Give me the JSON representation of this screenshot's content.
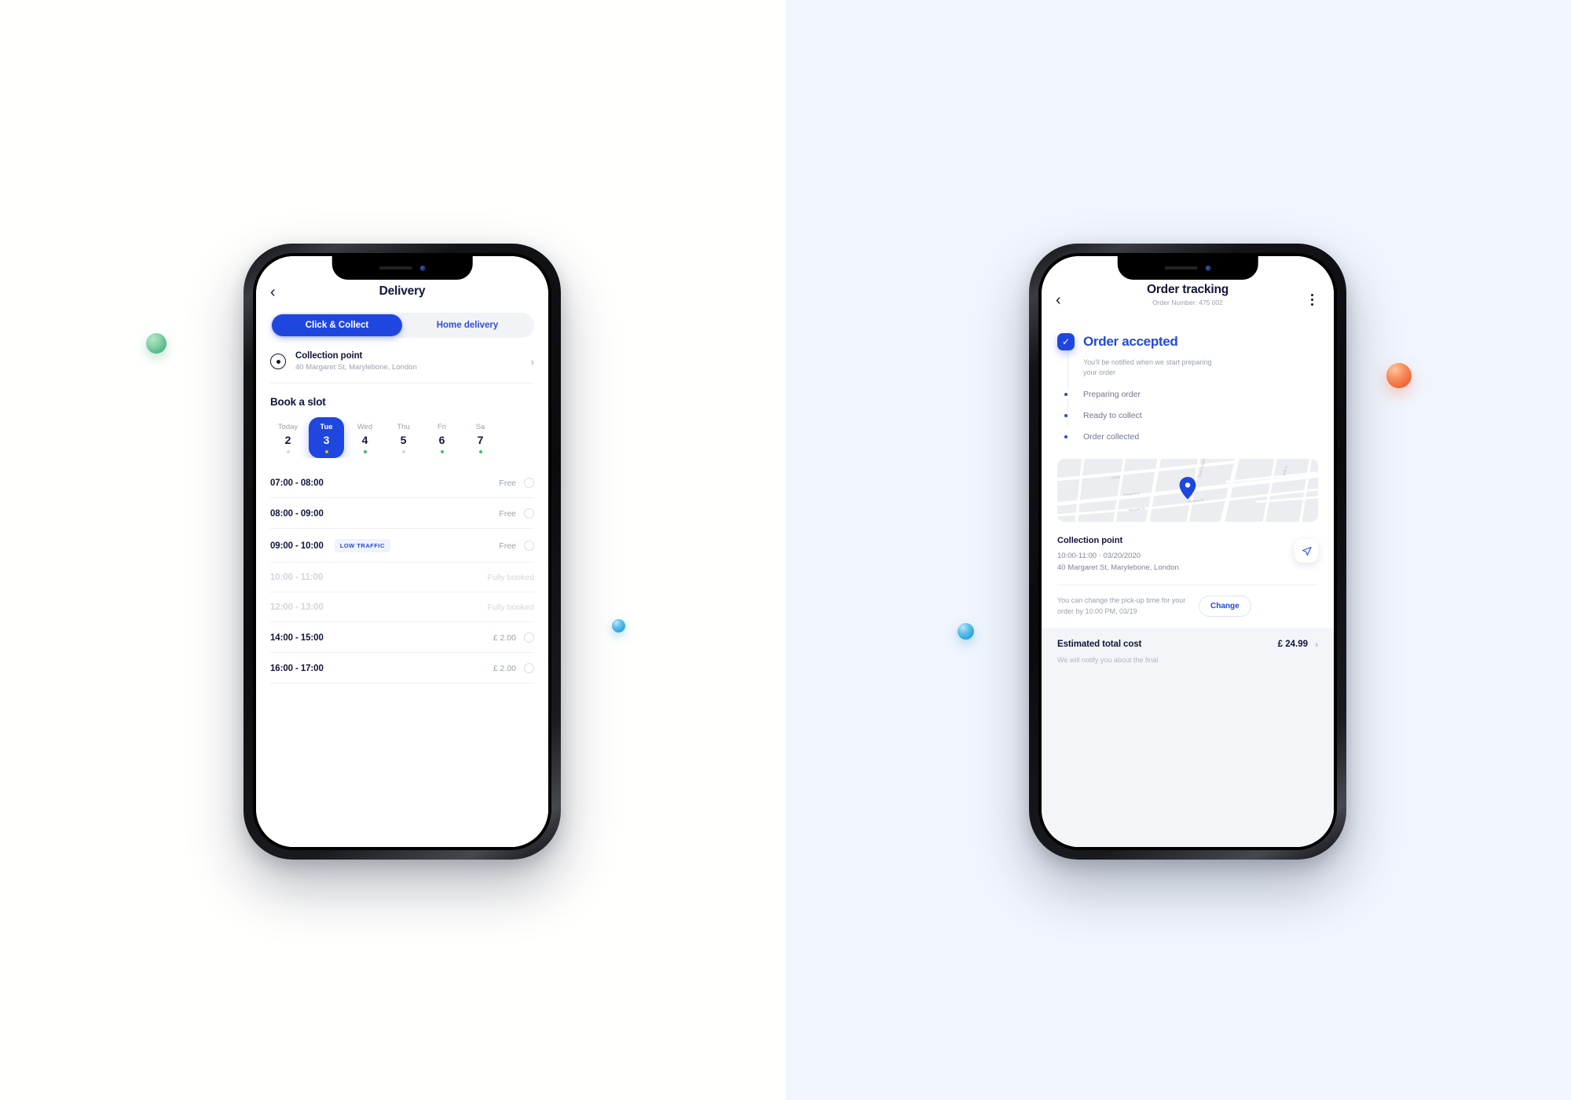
{
  "canvas": {
    "left_bg": "#FFFFFE",
    "right_bg": "#F1F5FD",
    "accent": "#1F47E0",
    "accent_text": "#2348DD"
  },
  "decorations": [
    {
      "name": "green-sphere",
      "color": "#4FB383"
    },
    {
      "name": "orange-sphere",
      "color": "#F2683A"
    },
    {
      "name": "blue-sphere-small",
      "color": "#2AA3DD"
    },
    {
      "name": "blue-sphere-large",
      "color": "#2AA3DD"
    }
  ],
  "left_phone": {
    "nav": {
      "back_icon": "chevron-left-icon",
      "title": "Delivery"
    },
    "segmented": {
      "options": [
        {
          "label": "Click & Collect",
          "active": true
        },
        {
          "label": "Home delivery",
          "active": false
        }
      ]
    },
    "collection_point": {
      "icon": "location-pin-icon",
      "title": "Collection point",
      "address": "40 Margaret St, Marylebone, London",
      "chevron": "›"
    },
    "book_slot": {
      "section_title": "Book a slot",
      "days": [
        {
          "name": "Today",
          "num": "2",
          "dot": "#D6D8E0",
          "selected": false
        },
        {
          "name": "Tue",
          "num": "3",
          "dot": "#F5B315",
          "selected": true
        },
        {
          "name": "Wed",
          "num": "4",
          "dot": "#3CBF6B",
          "selected": false
        },
        {
          "name": "Thu",
          "num": "5",
          "dot": "#D6D8E0",
          "selected": false
        },
        {
          "name": "Fri",
          "num": "6",
          "dot": "#3CBF6B",
          "selected": false
        },
        {
          "name": "Sa",
          "num": "7",
          "dot": "#3CBF6B",
          "selected": false
        }
      ],
      "slots": [
        {
          "time": "07:00 - 08:00",
          "badge": "",
          "price": "Free",
          "available": true
        },
        {
          "time": "08:00 - 09:00",
          "badge": "",
          "price": "Free",
          "available": true
        },
        {
          "time": "09:00 - 10:00",
          "badge": "LOW TRAFFIC",
          "price": "Free",
          "available": true
        },
        {
          "time": "10:00 - 11:00",
          "badge": "",
          "price": "Fully booked",
          "available": false
        },
        {
          "time": "12:00 - 13:00",
          "badge": "",
          "price": "Fully booked",
          "available": false
        },
        {
          "time": "14:00 - 15:00",
          "badge": "",
          "price": "£ 2.00",
          "available": true
        },
        {
          "time": "16:00 - 17:00",
          "badge": "",
          "price": "£ 2.00",
          "available": true
        }
      ]
    }
  },
  "right_phone": {
    "nav": {
      "back_icon": "chevron-left-icon",
      "title": "Order tracking",
      "subtitle": "Order Number: 475 002",
      "menu_icon": "kebab-menu-icon"
    },
    "tracking": {
      "current_step": "Order accepted",
      "current_check_icon": "check-icon",
      "current_note": "You'll be notified when we start preparing your order",
      "upcoming_steps": [
        {
          "label": "Preparing order"
        },
        {
          "label": "Ready to collect"
        },
        {
          "label": "Order collected"
        }
      ]
    },
    "map": {
      "pin_icon": "map-pin-icon",
      "labels": [
        "A3204",
        "Margaret St",
        "Great Titchfield St",
        "Margaret St",
        "Wells St"
      ]
    },
    "collection_point": {
      "title": "Collection point",
      "time_date": "10:00-11:00  ·  03/20/2020",
      "address": "40 Margaret St, Marylebone, London",
      "navigate_icon": "navigate-arrow-icon"
    },
    "change": {
      "note": "You can change the pick-up time for your order by 10:00 PM, 03/19",
      "button_label": "Change"
    },
    "total": {
      "label": "Estimated total cost",
      "value": "£ 24.99",
      "chevron": "›",
      "note": "We will notify you about the final"
    }
  }
}
